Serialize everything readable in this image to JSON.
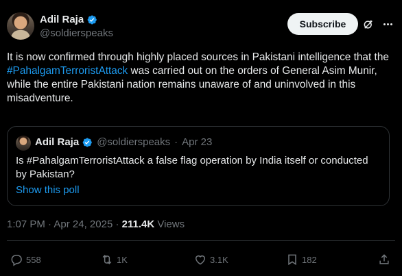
{
  "author": {
    "name": "Adil Raja",
    "handle": "@soldierspeaks"
  },
  "header": {
    "subscribe_label": "Subscribe",
    "grok_icon": "grok-icon",
    "more_icon": "more-icon"
  },
  "tweet": {
    "text_part1": "It is now confirmed through highly placed sources in Pakistani intelligence that the ",
    "hashtag": "#PahalgamTerroristAttack",
    "text_part2": " was carried out on the orders of General Asim Munir, while the entire Pakistani nation remains unaware of and uninvolved in this misadventure."
  },
  "quote": {
    "name": "Adil Raja",
    "handle": "@soldierspeaks",
    "separator": "·",
    "date": "Apr 23",
    "text": "Is #PahalgamTerroristAttack a false flag operation by India itself or conducted by Pakistan?",
    "poll_link": "Show this poll"
  },
  "meta": {
    "time": "1:07 PM",
    "separator": "·",
    "date": "Apr 24, 2025",
    "views_count": "211.4K",
    "views_label": "Views"
  },
  "actions": {
    "replies": "558",
    "reposts": "1K",
    "likes": "3.1K",
    "bookmarks": "182"
  },
  "colors": {
    "background": "#000000",
    "text": "#e7e9ea",
    "secondary": "#71767b",
    "accent": "#1d9bf0",
    "border": "#2f3336"
  }
}
